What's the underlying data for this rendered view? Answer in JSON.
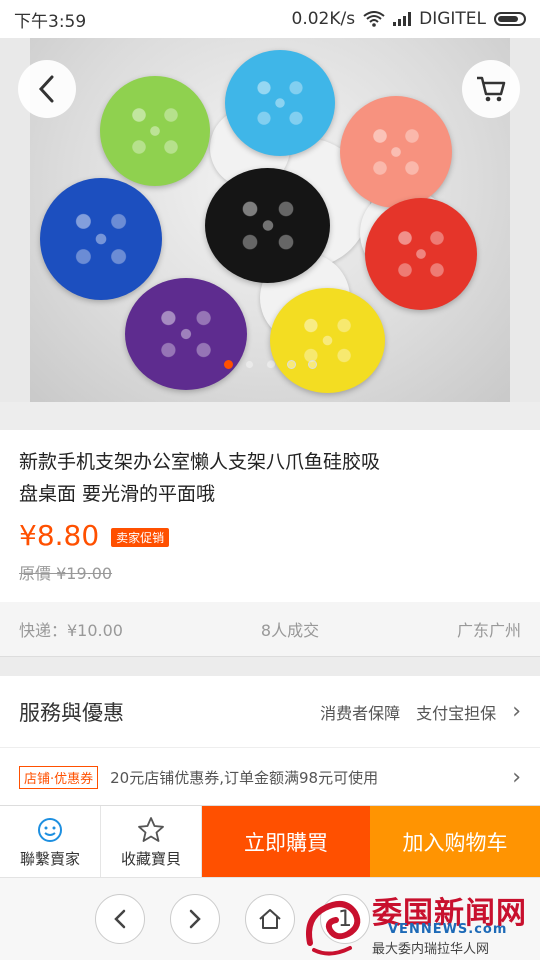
{
  "status_bar": {
    "time": "下午3:59",
    "speed": "0.02K/s",
    "carrier": "DIGITEL"
  },
  "hero": {
    "back_icon": "chevron-left-icon",
    "cart_icon": "cart-icon",
    "image_count": 5,
    "active_image": 1,
    "cup_colors": [
      "#8fd14f",
      "#3fb6e8",
      "#f7927f",
      "#1c4fbf",
      "#151515",
      "#e5352a",
      "#5e2c8f",
      "#f3dd22"
    ]
  },
  "product": {
    "title_line1": "新款手机支架办公室懒人支架八爪鱼硅胶吸",
    "title_line2": "盘桌面 要光滑的平面哦",
    "price": "¥8.80",
    "promo_badge": "卖家促销",
    "original_price": "原價 ¥19.00"
  },
  "meta": {
    "shipping": "快递：¥10.00",
    "sold": "8人成交",
    "location": "广东广州"
  },
  "service": {
    "title": "服務與優惠",
    "guarantee1": "消费者保障",
    "guarantee2": "支付宝担保"
  },
  "coupon": {
    "tag": "店铺·优惠券",
    "text": "20元店铺优惠券,订单金额满98元可使用"
  },
  "actions": {
    "contact_seller": "聯繫賣家",
    "favorite": "收藏寶貝",
    "buy_now": "立即購買",
    "add_to_cart": "加入购物车"
  },
  "nav": {
    "tab_count": "1"
  },
  "watermark": {
    "cn": "委国新闻网",
    "en": "VENNEWS.com",
    "sub": "最大委内瑞拉华人网"
  },
  "colors": {
    "accent": "#ff5000",
    "cart_orange": "#ff9402",
    "watermark_red": "#c8102e",
    "watermark_blue": "#1d6ab7"
  }
}
